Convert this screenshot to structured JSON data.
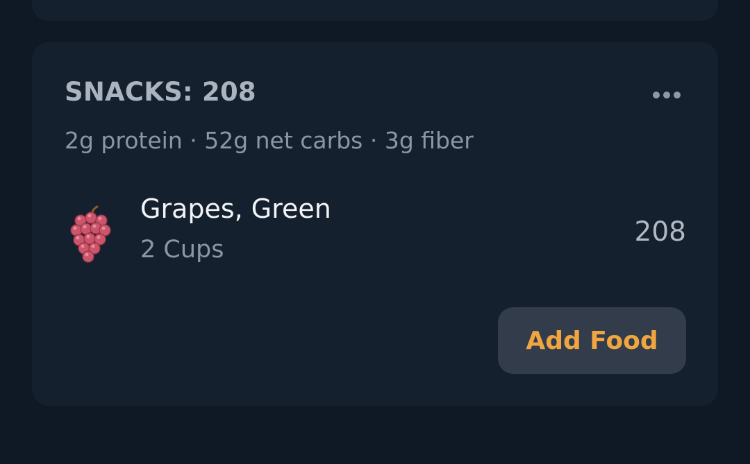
{
  "meal_section": {
    "title": "SNACKS: 208",
    "macros": "2g protein · 52g net carbs · 3g fiber",
    "more_icon": "ellipsis-horizontal-icon",
    "items": [
      {
        "icon": "grapes-icon",
        "name": "Grapes, Green",
        "portion": "2 Cups",
        "calories": "208"
      }
    ],
    "add_food_label": "Add Food"
  },
  "colors": {
    "background": "#0f1925",
    "card": "#15202f",
    "accent": "#f0a541",
    "button_bg": "#323c4a"
  }
}
